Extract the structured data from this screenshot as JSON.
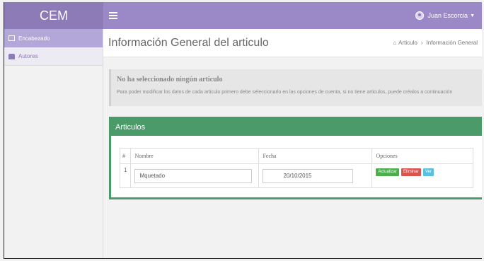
{
  "app": {
    "brand": "CEM"
  },
  "user": {
    "name": "Juan Escorcia"
  },
  "sidebar": {
    "items": [
      {
        "label": "Encabezado",
        "icon": "list-icon",
        "active": true
      },
      {
        "label": "Autores",
        "icon": "users-icon",
        "active": false
      }
    ]
  },
  "header": {
    "title": "Información General del articulo",
    "breadcrumb": [
      "Articulo",
      "Información General"
    ]
  },
  "notice": {
    "title": "No ha seleccionado ningún articulo",
    "text": "Para poder modificar los datos de cada articulo primero debe seleccionarlo en las opciones de cuenta, si no tiene articulos, puede créalos a continuación"
  },
  "panel": {
    "title": "Articulos",
    "columns": [
      "#",
      "Nombre",
      "Fecha",
      "Opciones"
    ],
    "rows": [
      {
        "num": "1",
        "nombre": "Mquetado",
        "fecha": "20/10/2015",
        "actions": [
          "Actualizar",
          "Eliminar",
          "Ver"
        ]
      }
    ]
  },
  "colors": {
    "brand": "#8c7bb6",
    "topbar": "#9a89c6",
    "panel": "#4b9a6a",
    "btn_update": "#4cae4c",
    "btn_delete": "#d9534f",
    "btn_view": "#5bc0de"
  }
}
